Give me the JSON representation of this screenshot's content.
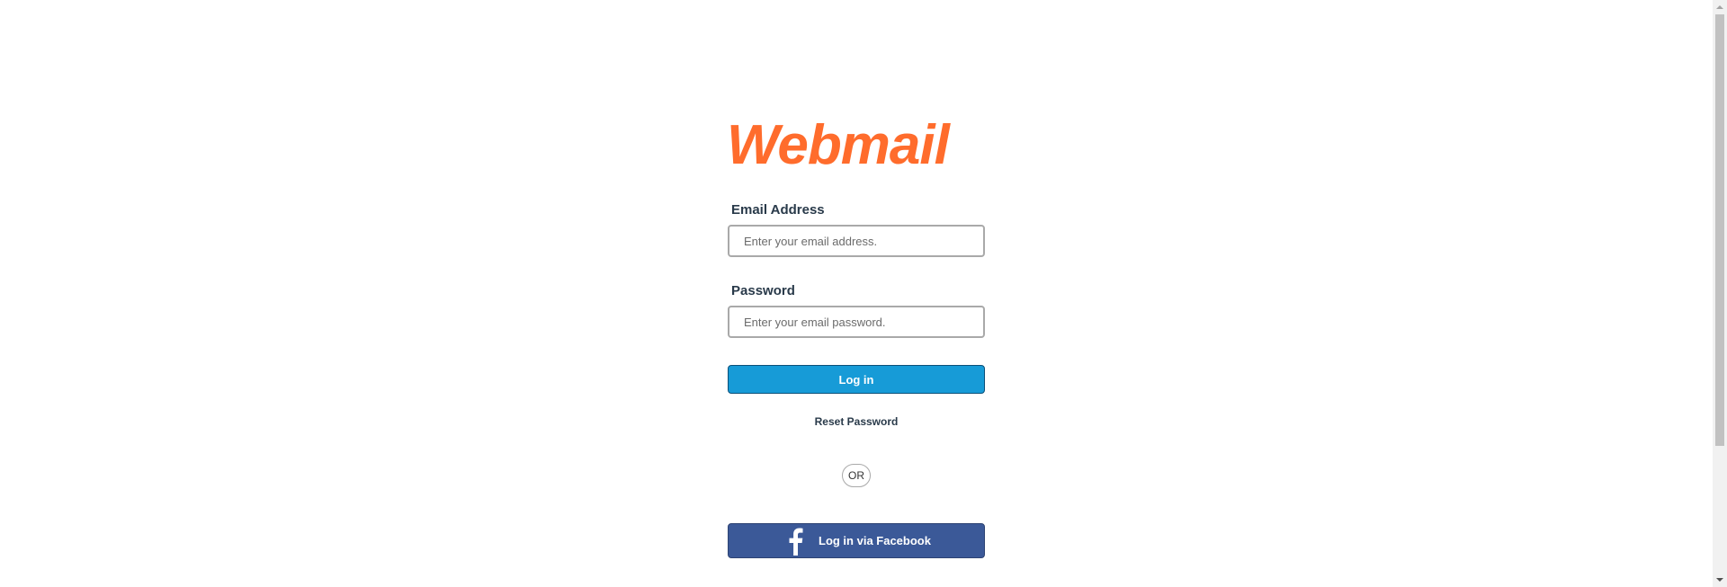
{
  "brand": {
    "logo_text": "Webmail",
    "logo_color": "#ff6c2c"
  },
  "form": {
    "email_label": "Email Address",
    "email_placeholder": "Enter your email address.",
    "email_value": "",
    "password_label": "Password",
    "password_placeholder": "Enter your email password.",
    "password_value": "",
    "login_label": "Log in",
    "reset_label": "Reset Password",
    "or_label": "OR",
    "facebook_label": "Log in via Facebook"
  },
  "colors": {
    "primary_button": "#179bd7",
    "facebook_button": "#3b5998",
    "label_text": "#293a4a"
  },
  "icons": {
    "facebook": "facebook-icon",
    "scroll_up": "chevron-up-icon",
    "scroll_down": "chevron-down-icon"
  }
}
